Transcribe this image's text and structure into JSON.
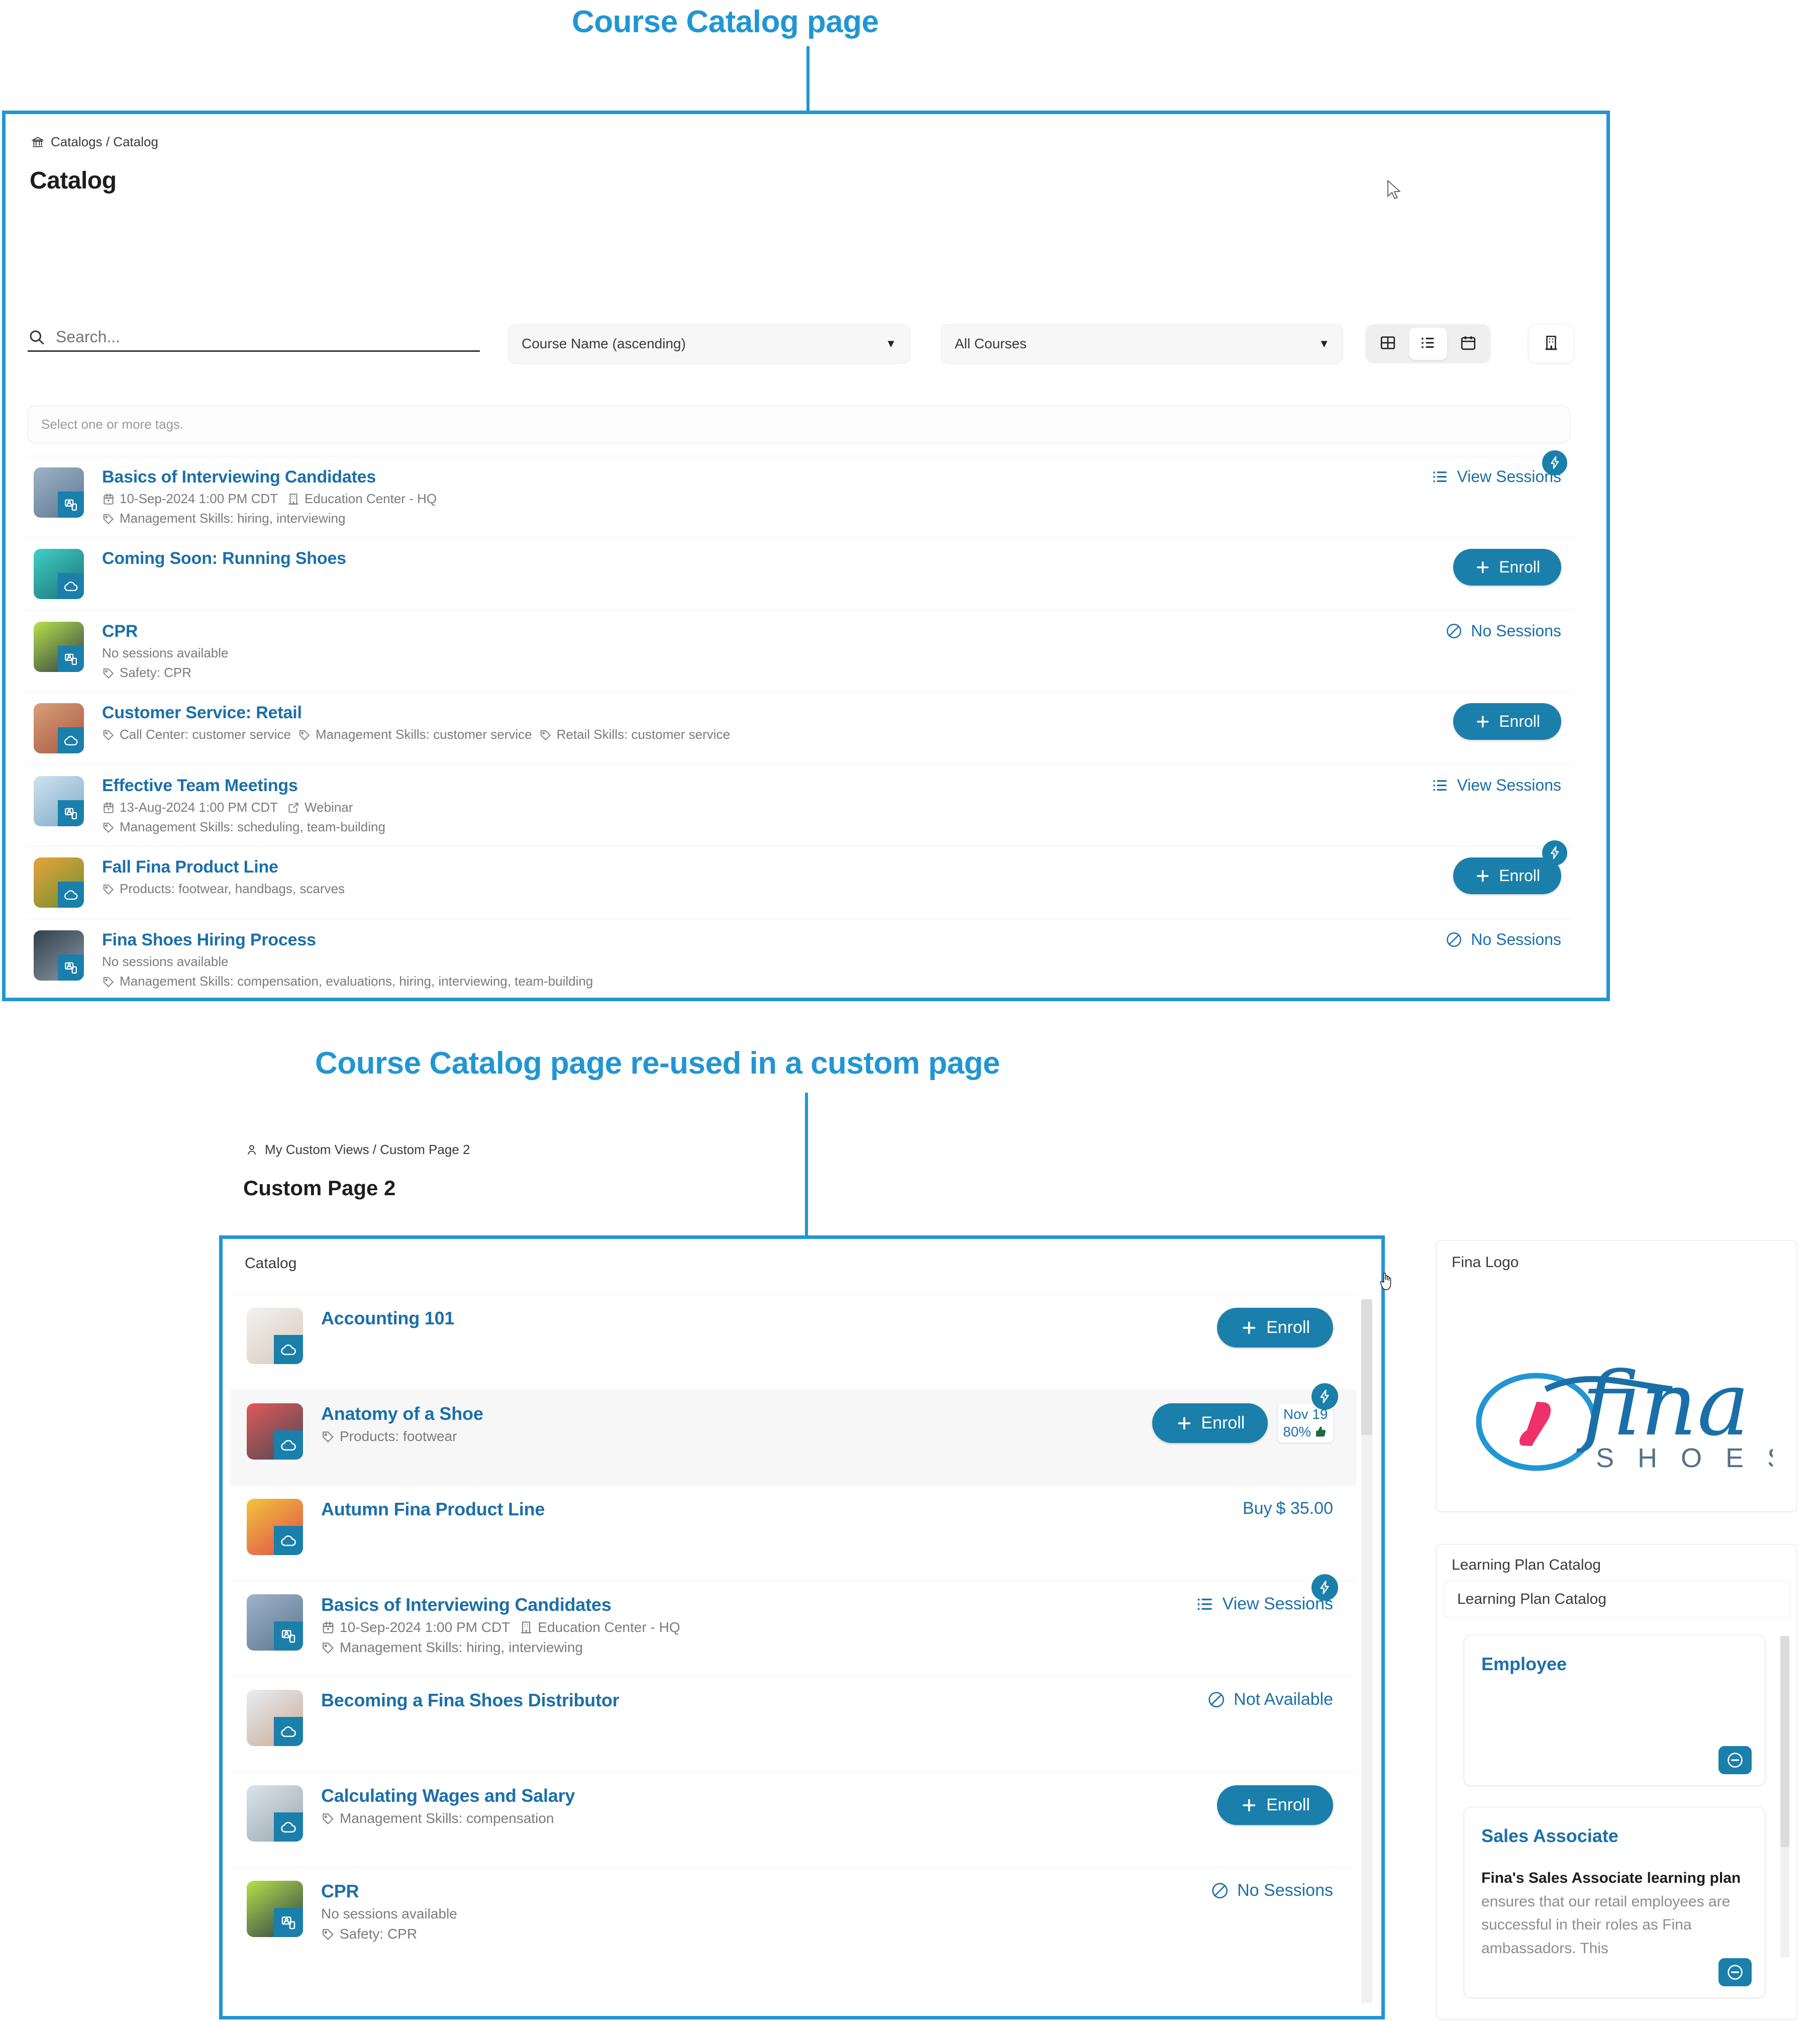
{
  "annotations": {
    "top_label": "Course Catalog page",
    "bottom_label": "Course Catalog page re-used in a custom page"
  },
  "colors": {
    "accent_blue": "#2196d3",
    "link_blue": "#1b6fa8",
    "button_blue": "#1b7fab",
    "muted_gray": "#7b7b7b"
  },
  "catalog_page": {
    "breadcrumb": "Catalogs / Catalog",
    "breadcrumb_icon": "bank-icon",
    "title": "Catalog",
    "search": {
      "placeholder": "Search...",
      "value": "",
      "icon": "search-icon"
    },
    "sort_select": {
      "value": "Course Name (ascending)"
    },
    "filter_select": {
      "value": "All Courses"
    },
    "view_toggle": [
      {
        "icon": "grid-view-icon",
        "label": "Grid",
        "active": false
      },
      {
        "icon": "list-view-icon",
        "label": "List",
        "active": true
      },
      {
        "icon": "calendar-view-icon",
        "label": "Calendar",
        "active": false
      }
    ],
    "location_button": {
      "icon": "building-icon",
      "label": "Locations"
    },
    "tags_input": {
      "placeholder": "Select one or more tags.",
      "value": ""
    },
    "courses": [
      {
        "title": "Basics of Interviewing Candidates",
        "date": "10-Sep-2024 1:00 PM CDT",
        "venue": "Education Center - HQ",
        "venue_icon": "building-icon",
        "tags": "Management Skills: hiring, interviewing",
        "no_sessions_text": "",
        "action": {
          "type": "link",
          "label": "View Sessions",
          "icon": "list-icon"
        },
        "lightning_badge": true,
        "type_icon": "instructor-led-icon",
        "thumb_colors": [
          "#9fb3c8",
          "#5b7790"
        ]
      },
      {
        "title": "Coming Soon: Running Shoes",
        "date": "",
        "venue": "",
        "tags": "",
        "no_sessions_text": "",
        "action": {
          "type": "button",
          "label": "Enroll",
          "icon": "plus-icon"
        },
        "lightning_badge": false,
        "type_icon": "online-icon",
        "thumb_colors": [
          "#3fd0c4",
          "#1d6f78"
        ]
      },
      {
        "title": "CPR",
        "date": "",
        "venue": "",
        "tags": "Safety: CPR",
        "no_sessions_text": "No sessions available",
        "action": {
          "type": "link",
          "label": "No Sessions",
          "icon": "no-entry-icon"
        },
        "lightning_badge": false,
        "type_icon": "instructor-led-icon",
        "thumb_colors": [
          "#b5e24a",
          "#2d3a46"
        ]
      },
      {
        "title": "Customer Service: Retail",
        "date": "",
        "venue": "",
        "tags": "Call Center: customer service|Management Skills: customer service|Retail Skills: customer service",
        "no_sessions_text": "",
        "action": {
          "type": "button",
          "label": "Enroll",
          "icon": "plus-icon"
        },
        "lightning_badge": false,
        "type_icon": "online-icon",
        "thumb_colors": [
          "#d8a07a",
          "#a8563f"
        ]
      },
      {
        "title": "Effective Team Meetings",
        "date": "13-Aug-2024 1:00 PM CDT",
        "venue": "Webinar",
        "venue_icon": "external-link-icon",
        "tags": "Management Skills: scheduling, team-building",
        "no_sessions_text": "",
        "action": {
          "type": "link",
          "label": "View Sessions",
          "icon": "list-icon"
        },
        "lightning_badge": false,
        "type_icon": "instructor-led-icon",
        "thumb_colors": [
          "#cfe3f0",
          "#7da8c7"
        ]
      },
      {
        "title": "Fall Fina Product Line",
        "date": "",
        "venue": "",
        "tags": "Products: footwear, handbags, scarves",
        "no_sessions_text": "",
        "action": {
          "type": "button",
          "label": "Enroll",
          "icon": "plus-icon"
        },
        "lightning_badge": true,
        "type_icon": "online-icon",
        "thumb_colors": [
          "#e8a33d",
          "#6d8f2e"
        ]
      },
      {
        "title": "Fina Shoes Hiring Process",
        "date": "",
        "venue": "",
        "tags": "Management Skills: compensation, evaluations, hiring, interviewing, team-building",
        "no_sessions_text": "No sessions available",
        "action": {
          "type": "link",
          "label": "No Sessions",
          "icon": "no-entry-icon"
        },
        "lightning_badge": false,
        "type_icon": "instructor-led-icon",
        "thumb_colors": [
          "#30404c",
          "#8d9aa4"
        ]
      }
    ]
  },
  "custom_page": {
    "breadcrumb": "My Custom Views / Custom Page 2",
    "breadcrumb_icon": "user-icon",
    "title": "Custom Page 2",
    "catalog_widget_title": "Catalog",
    "courses": [
      {
        "title": "Accounting 101",
        "tags": "",
        "no_sessions_text": "",
        "action": {
          "type": "button",
          "label": "Enroll",
          "icon": "plus-icon"
        },
        "lightning_badge": false,
        "type_icon": "online-icon",
        "thumb_colors": [
          "#f2f2f2",
          "#d9c8b8"
        ]
      },
      {
        "title": "Anatomy of a Shoe",
        "tags": "Products: footwear",
        "no_sessions_text": "",
        "action": {
          "type": "button",
          "label": "Enroll",
          "icon": "plus-icon"
        },
        "lightning_badge": true,
        "date_badge": {
          "date": "Nov 19",
          "percent": "80%",
          "icon": "thumbs-up-icon"
        },
        "type_icon": "online-icon",
        "thumb_colors": [
          "#e0585c",
          "#4a4a52"
        ]
      },
      {
        "title": "Autumn Fina Product Line",
        "tags": "",
        "no_sessions_text": "",
        "action": {
          "type": "price",
          "label": "Buy",
          "amount": "$ 35.00",
          "icon": "dollar-icon"
        },
        "lightning_badge": false,
        "type_icon": "online-icon",
        "thumb_colors": [
          "#f2c53d",
          "#e04a4a"
        ]
      },
      {
        "title": "Basics of Interviewing Candidates",
        "date": "10-Sep-2024 1:00 PM CDT",
        "venue": "Education Center - HQ",
        "venue_icon": "building-icon",
        "tags": "Management Skills: hiring, interviewing",
        "no_sessions_text": "",
        "action": {
          "type": "link",
          "label": "View Sessions",
          "icon": "list-icon"
        },
        "lightning_badge": true,
        "type_icon": "instructor-led-icon",
        "thumb_colors": [
          "#9fb3c8",
          "#5b7790"
        ]
      },
      {
        "title": "Becoming a Fina Shoes Distributor",
        "tags": "",
        "no_sessions_text": "",
        "action": {
          "type": "link",
          "label": "Not Available",
          "icon": "no-entry-icon"
        },
        "lightning_badge": false,
        "type_icon": "online-icon",
        "thumb_colors": [
          "#e9eef2",
          "#c9a996"
        ]
      },
      {
        "title": "Calculating Wages and Salary",
        "tags": "Management Skills: compensation",
        "no_sessions_text": "",
        "action": {
          "type": "button",
          "label": "Enroll",
          "icon": "plus-icon"
        },
        "lightning_badge": false,
        "type_icon": "online-icon",
        "thumb_colors": [
          "#dbe4ea",
          "#9aa7b2"
        ]
      },
      {
        "title": "CPR",
        "tags": "Safety: CPR",
        "no_sessions_text": "No sessions available",
        "action": {
          "type": "link",
          "label": "No Sessions",
          "icon": "no-entry-icon"
        },
        "lightning_badge": false,
        "type_icon": "instructor-led-icon",
        "thumb_colors": [
          "#b5e24a",
          "#2d3a46"
        ]
      }
    ],
    "sidebar": {
      "logo_widget": {
        "title": "Fina Logo",
        "brand_name": "fina",
        "brand_sub": "S H O E S"
      },
      "learning_plan_widget": {
        "title": "Learning Plan Catalog",
        "subtitle": "Learning Plan Catalog",
        "plans": [
          {
            "name": "Employee",
            "description": "",
            "minus_icon": "minus-circle-icon"
          },
          {
            "name": "Sales Associate",
            "description_bold": "Fina's Sales Associate learning plan",
            "description": " ensures that our retail employees are successful in their roles as Fina ambassadors. This",
            "minus_icon": "minus-circle-icon"
          }
        ]
      }
    }
  }
}
